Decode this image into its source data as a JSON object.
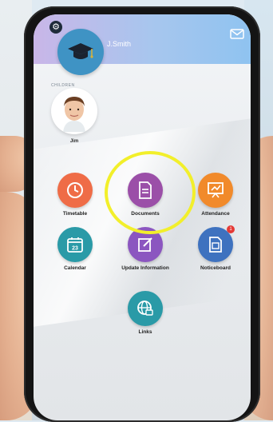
{
  "header": {
    "user_name": "J.Smith",
    "gear_icon": "gear-icon",
    "mail_icon": "mail-icon",
    "logo_icon": "graduation-cap-icon"
  },
  "children": {
    "label": "CHILDREN",
    "items": [
      {
        "name": "Jim"
      }
    ]
  },
  "tiles": [
    {
      "label": "Timetable",
      "icon": "clock-icon",
      "color": "#ef6c47"
    },
    {
      "label": "Documents",
      "icon": "document-icon",
      "color": "#9b4fa8"
    },
    {
      "label": "Attendance",
      "icon": "presentation-icon",
      "color": "#f18a2b"
    },
    {
      "label": "Calendar",
      "icon": "calendar-icon",
      "color": "#2a9aa7"
    },
    {
      "label": "Update Information",
      "icon": "edit-icon",
      "color": "#8b56c0"
    },
    {
      "label": "Noticeboard",
      "icon": "noticeboard-icon",
      "color": "#3e72bf",
      "badge": "1"
    },
    {
      "label": "Links",
      "icon": "globe-icon",
      "color": "#2a9aa7"
    }
  ],
  "calendar_icon_number": "23",
  "colors": {
    "highlight": "#f2ef2b",
    "header_start": "#c9b6e8",
    "header_end": "#8fc3f0"
  }
}
